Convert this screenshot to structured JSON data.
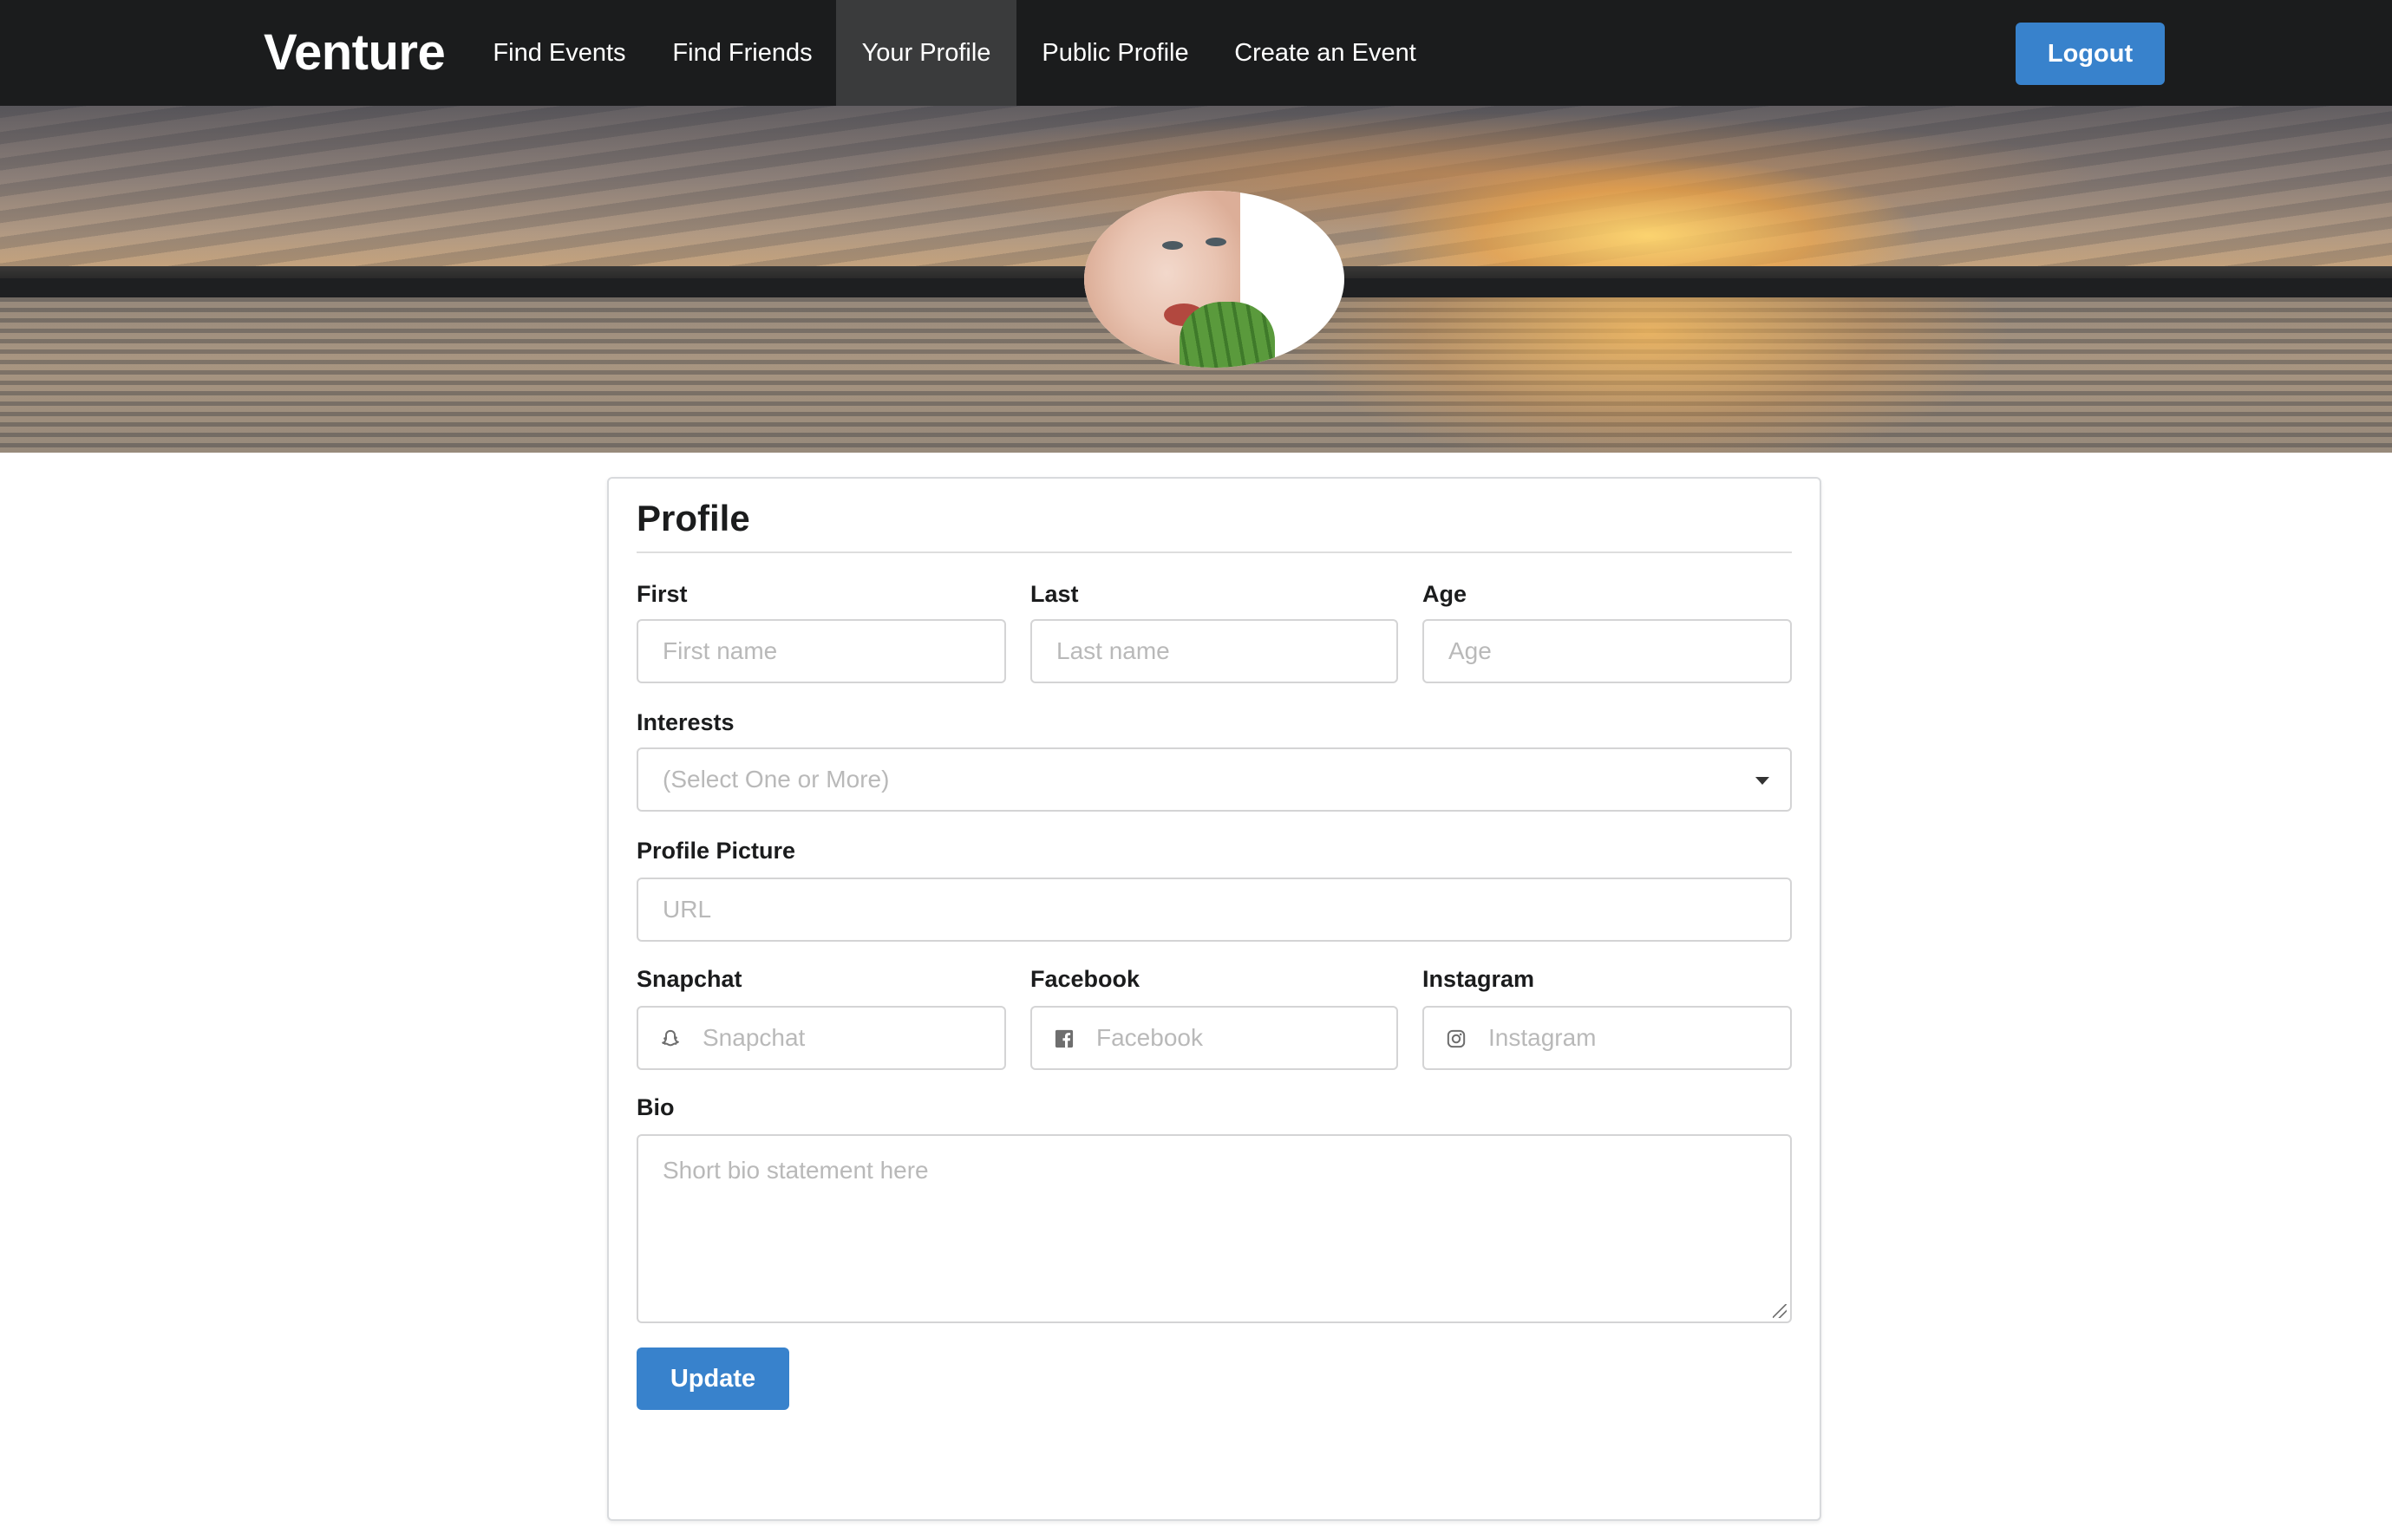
{
  "nav": {
    "brand": "Venture",
    "items": [
      {
        "label": "Find Events",
        "active": false
      },
      {
        "label": "Find Friends",
        "active": false
      },
      {
        "label": "Your Profile",
        "active": true
      },
      {
        "label": "Public Profile",
        "active": false
      },
      {
        "label": "Create an Event",
        "active": false
      }
    ],
    "logout_label": "Logout"
  },
  "profile_form": {
    "title": "Profile",
    "fields": {
      "first": {
        "label": "First",
        "placeholder": "First name",
        "value": ""
      },
      "last": {
        "label": "Last",
        "placeholder": "Last name",
        "value": ""
      },
      "age": {
        "label": "Age",
        "placeholder": "Age",
        "value": ""
      },
      "interests": {
        "label": "Interests",
        "placeholder": "(Select One or More)",
        "value": ""
      },
      "profile_picture": {
        "label": "Profile Picture",
        "placeholder": "URL",
        "value": ""
      },
      "snapchat": {
        "label": "Snapchat",
        "placeholder": "Snapchat",
        "icon": "snapchat-icon",
        "value": ""
      },
      "facebook": {
        "label": "Facebook",
        "placeholder": "Facebook",
        "icon": "facebook-icon",
        "value": ""
      },
      "instagram": {
        "label": "Instagram",
        "placeholder": "Instagram",
        "icon": "instagram-icon",
        "value": ""
      },
      "bio": {
        "label": "Bio",
        "placeholder": "Short bio statement here",
        "value": ""
      }
    },
    "update_label": "Update"
  },
  "colors": {
    "nav_background": "#1b1c1d",
    "nav_active": "#3a3b3c",
    "primary_button": "#3882cc",
    "input_border": "#d4d4d5",
    "placeholder_text": "#b9b9b9"
  }
}
